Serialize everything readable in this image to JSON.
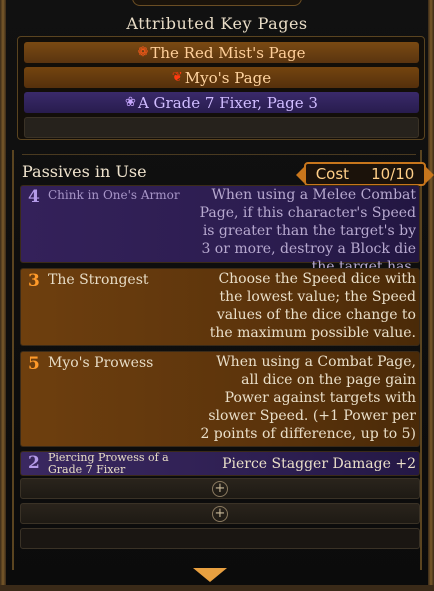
{
  "attributed": {
    "title": "Attributed Key Pages",
    "pages": [
      {
        "label": "The Red Mist's Page",
        "icon": "red-mist-emblem-icon",
        "color": "#ffcf9a"
      },
      {
        "label": "Myo's Page",
        "icon": "myo-emblem-icon",
        "color": "#ffd4a0"
      },
      {
        "label": "A Grade 7 Fixer, Page 3",
        "icon": "fixer-emblem-icon",
        "color": "#d0bcff"
      }
    ]
  },
  "passives": {
    "title": "Passives in Use",
    "cost_label": "Cost",
    "cost_value": "10/10",
    "items": [
      {
        "cost": "4",
        "name": "Chink in One's Armor",
        "desc": "When using a Melee Combat Page, if this character's Speed is greater than the target's by 3 or more, destroy a Block die the target has."
      },
      {
        "cost": "3",
        "name": "The Strongest",
        "desc": "Choose the Speed dice with the lowest value; the Speed values of the dice change to the maximum possible value."
      },
      {
        "cost": "5",
        "name": "Myo's Prowess",
        "desc": "When using a Combat Page, all dice on the page gain Power against targets with slower Speed. (+1 Power per 2 points of difference, up to 5)"
      },
      {
        "cost": "2",
        "name": "Piercing Prowess of a Grade 7 Fixer",
        "desc": "Pierce Stagger Damage +2"
      }
    ],
    "add_symbol": "+"
  },
  "colors": {
    "accent": "#c8761c",
    "purple": "#34215a",
    "orange": "#6e3f0e"
  }
}
